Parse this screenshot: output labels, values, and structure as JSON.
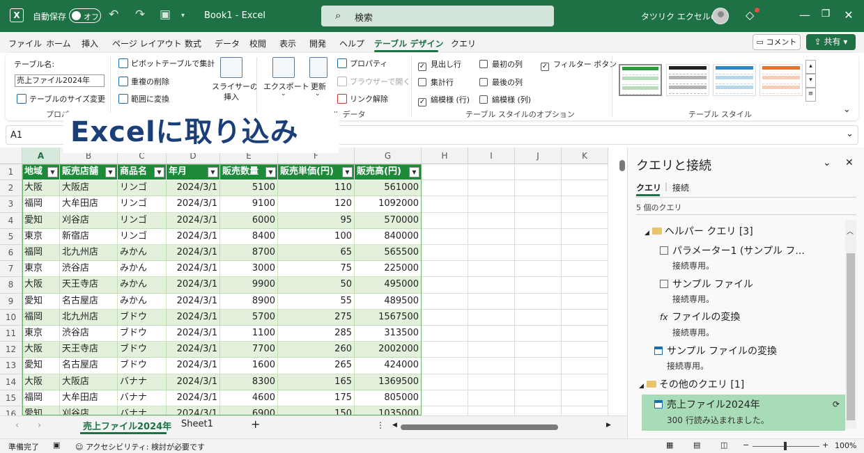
{
  "titlebar": {
    "autosave_label": "自動保存",
    "autosave_state": "オフ",
    "book_title": "Book1  -  Excel",
    "search_placeholder": "検索",
    "user_name": "タツリク エクセルの森"
  },
  "menu": {
    "tabs": [
      "ファイル",
      "ホーム",
      "挿入",
      "ページ レイアウト",
      "数式",
      "データ",
      "校閲",
      "表示",
      "開発",
      "ヘルプ",
      "テーブル デザイン",
      "クエリ"
    ],
    "comment_label": "コメント",
    "share_label": "共有"
  },
  "ribbon": {
    "table_name_label": "テーブル名:",
    "table_name_value": "売上ファイル2024年",
    "resize_label": "テーブルのサイズ変更",
    "group_properties": "プロパ",
    "pivot_label": "ピボットテーブルで集計",
    "dedupe_label": "重複の削除",
    "convert_label": "範囲に変換",
    "slicer_label_1": "スライサーの",
    "slicer_label_2": "挿入",
    "export_label": "エクスポート",
    "refresh_label": "更新",
    "properties_label": "プロパティ",
    "browser_label": "ブラウザーで開く",
    "unlink_label": "リンク解除",
    "group_external": "ル データ",
    "opt_header_row": "見出し行",
    "opt_total_row": "集計行",
    "opt_banded_rows": "縞模様 (行)",
    "opt_first_col": "最初の列",
    "opt_last_col": "最後の列",
    "opt_banded_cols": "縞模様 (列)",
    "opt_filter_btn": "フィルター ボタン",
    "group_style_options": "テーブル スタイルのオプション",
    "group_table_style": "テーブル スタイル",
    "swatch_colors": [
      "#2e9a3e",
      "#222222",
      "#2c86c8",
      "#e8722c"
    ]
  },
  "formula": {
    "name_box": "A1"
  },
  "overlay_title": "Excelに取り込み",
  "columns": [
    "A",
    "B",
    "C",
    "D",
    "E",
    "F",
    "G",
    "H",
    "I",
    "J",
    "K"
  ],
  "table": {
    "headers": [
      "地域",
      "販売店舗",
      "商品名",
      "年月",
      "販売数量",
      "販売単価(円)",
      "販売高(円)"
    ],
    "rows": [
      [
        "大阪",
        "大阪店",
        "リンゴ",
        "2024/3/1",
        "5100",
        "110",
        "561000"
      ],
      [
        "福岡",
        "大牟田店",
        "リンゴ",
        "2024/3/1",
        "9100",
        "120",
        "1092000"
      ],
      [
        "愛知",
        "刈谷店",
        "リンゴ",
        "2024/3/1",
        "6000",
        "95",
        "570000"
      ],
      [
        "東京",
        "新宿店",
        "リンゴ",
        "2024/3/1",
        "8400",
        "100",
        "840000"
      ],
      [
        "福岡",
        "北九州店",
        "みかん",
        "2024/3/1",
        "8700",
        "65",
        "565500"
      ],
      [
        "東京",
        "渋谷店",
        "みかん",
        "2024/3/1",
        "3000",
        "75",
        "225000"
      ],
      [
        "大阪",
        "天王寺店",
        "みかん",
        "2024/3/1",
        "9900",
        "50",
        "495000"
      ],
      [
        "愛知",
        "名古屋店",
        "みかん",
        "2024/3/1",
        "8900",
        "55",
        "489500"
      ],
      [
        "福岡",
        "北九州店",
        "ブドウ",
        "2024/3/1",
        "5700",
        "275",
        "1567500"
      ],
      [
        "東京",
        "渋谷店",
        "ブドウ",
        "2024/3/1",
        "1100",
        "285",
        "313500"
      ],
      [
        "大阪",
        "天王寺店",
        "ブドウ",
        "2024/3/1",
        "7700",
        "260",
        "2002000"
      ],
      [
        "愛知",
        "名古屋店",
        "ブドウ",
        "2024/3/1",
        "1600",
        "265",
        "424000"
      ],
      [
        "大阪",
        "大阪店",
        "バナナ",
        "2024/3/1",
        "8300",
        "165",
        "1369500"
      ],
      [
        "福岡",
        "大牟田店",
        "バナナ",
        "2024/3/1",
        "4600",
        "175",
        "805000"
      ],
      [
        "愛知",
        "刈谷店",
        "バナナ",
        "2024/3/1",
        "6900",
        "150",
        "1035000"
      ]
    ]
  },
  "sheets": {
    "active": "売上ファイル2024年",
    "other": "Sheet1",
    "add": "+"
  },
  "status": {
    "ready": "準備完了",
    "accessibility": "アクセシビリティ: 検討が必要です",
    "zoom": "100%"
  },
  "pane": {
    "title": "クエリと接続",
    "tab_queries": "クエリ",
    "tab_connections": "接続",
    "count": "5 個のクエリ",
    "helper_group": "ヘルパー クエリ [3]",
    "q1_name": "パラメーター1 (サンプル フ...",
    "q1_sub": "接続専用。",
    "q2_name": "サンプル ファイル",
    "q2_sub": "接続専用。",
    "q3_name": "ファイルの変換",
    "q3_sub": "接続専用。",
    "q4_name": "サンプル ファイルの変換",
    "q4_sub": "接続専用。",
    "other_group": "その他のクエリ [1]",
    "q5_name": "売上ファイル2024年",
    "q5_sub": "300 行読み込まれました。"
  }
}
